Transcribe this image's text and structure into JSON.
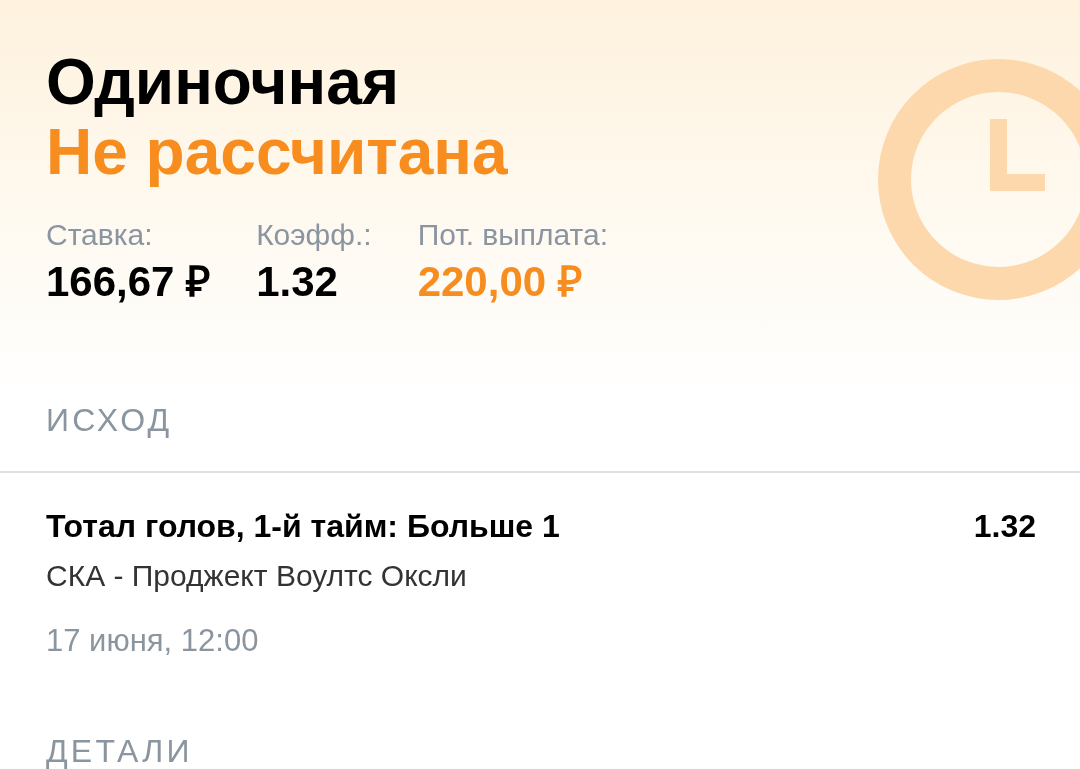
{
  "header": {
    "title": "Одиночная",
    "status": "Не рассчитана",
    "stats": [
      {
        "label": "Ставка:",
        "value": "166,67 ₽",
        "highlighted": false
      },
      {
        "label": "Коэфф.:",
        "value": "1.32",
        "highlighted": false
      },
      {
        "label": "Пот. выплата:",
        "value": "220,00 ₽",
        "highlighted": true
      }
    ]
  },
  "sections": [
    {
      "heading": "ИСХОД",
      "outcomes": [
        {
          "market": "Тотал голов, 1-й тайм: Больше 1",
          "odds": "1.32",
          "event": "СКА - Проджект Воултс Оксли",
          "date": "17 июня, 12:00"
        }
      ]
    },
    {
      "heading": "ДЕТАЛИ"
    }
  ]
}
